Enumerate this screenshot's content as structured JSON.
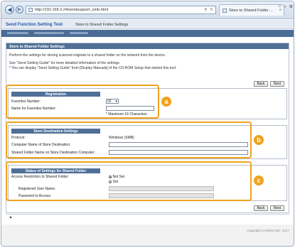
{
  "browser": {
    "address": "http://192.168.3.24/sendsupport_smb.html",
    "tab_label": "Store to Shared Folder ...",
    "search_icon": "search-icon",
    "refresh_icon": "refresh-icon",
    "win_icons": [
      "home-icon",
      "star-icon",
      "gear-icon"
    ]
  },
  "header": {
    "app_title": "Send Function Setting Tool",
    "breadcrumb": "Store to Shared Folder Settings"
  },
  "page": {
    "title": "Store to Shared Folder Settings",
    "desc_line1": "Perform the settings for storing scanned originals to a shared folder on the network from the device.",
    "desc_line2": "See \"Send Setting Guide\" for more detailed information of the settings.",
    "desc_line3": "* You can display \"Send Setting Guide\" from [Display Manuals] of the CD-ROM Setup that started this tool.",
    "back_label": "Back",
    "next_label": "Next"
  },
  "registration": {
    "heading": "Registration",
    "favorites_number_label": "Favorites Number:",
    "favorites_number_value": "02",
    "name_label": "Name for Favorites Number:",
    "name_value": "",
    "max_note": "* Maximum 16 Characters"
  },
  "destination": {
    "heading": "Store Destination Settings",
    "protocol_label": "Protocol:",
    "protocol_value": "Windows (SMB)",
    "computer_name_label": "Computer Name of Store Destination:",
    "computer_name_value": "",
    "shared_folder_label": "Shared Folder Name on Store Destination Computer:",
    "shared_folder_value": ""
  },
  "status": {
    "heading": "Status of Settings for Shared Folder",
    "access_label": "Access Restriction to Shared Folder:",
    "option_not_set": "Not Set",
    "option_set": "Set",
    "user_label": "Registered User Name:",
    "password_label": "Password to Access:"
  },
  "callouts": [
    "a",
    "b",
    "c"
  ],
  "footer": {
    "copyright": "Copyright CANON INC. 2017"
  },
  "colors": {
    "accent": "#f0a21f",
    "header_blue": "#4f6f96",
    "title_blue": "#2358a6"
  }
}
